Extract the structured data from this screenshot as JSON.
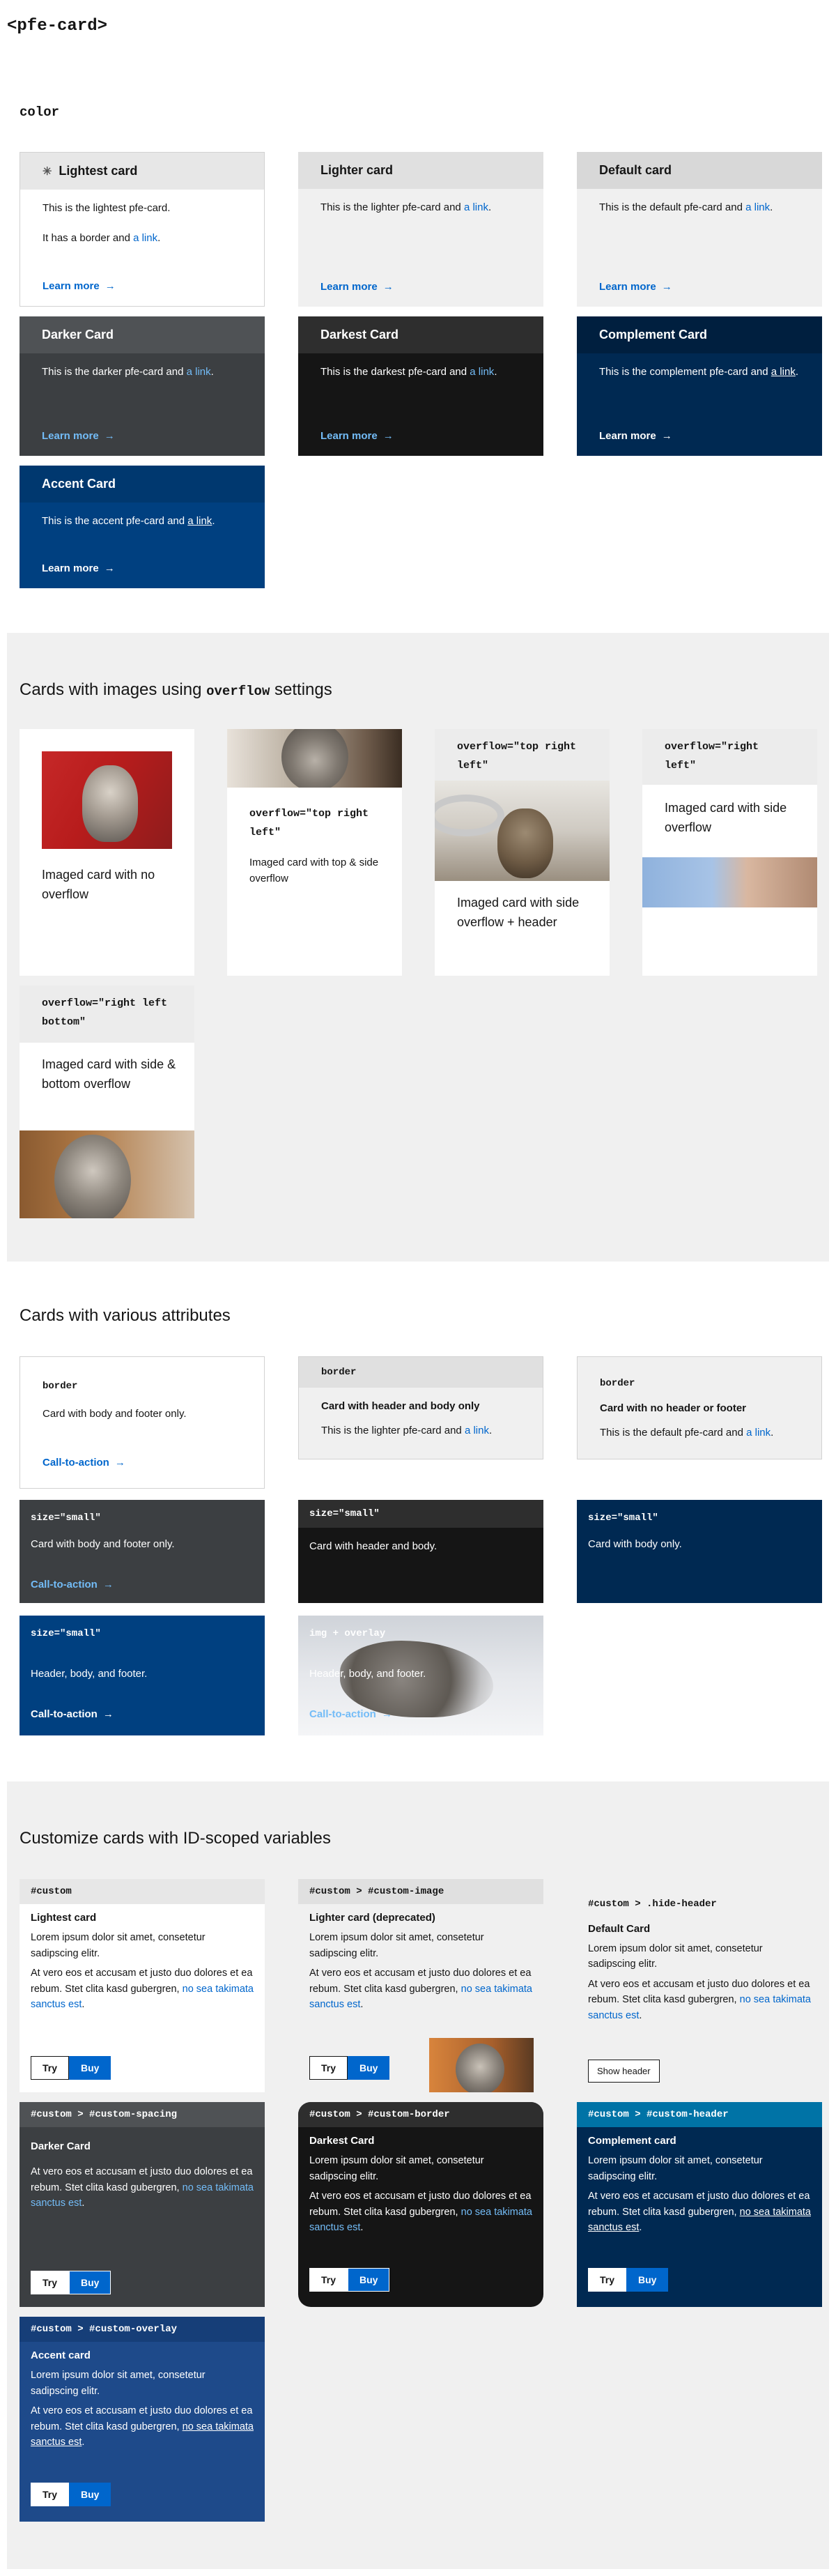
{
  "page_title": "<pfe-card>",
  "color_section": {
    "heading": "color",
    "cards": [
      {
        "title": "Lightest card",
        "body1": "This is the lightest pfe-card.",
        "body2": "It has a border and ",
        "link": "a link",
        "link_tail": ".",
        "footer": "Learn more"
      },
      {
        "title": "Lighter card",
        "body1": "This is the lighter pfe-card and ",
        "link": "a link",
        "link_tail": ".",
        "footer": "Learn more"
      },
      {
        "title": "Default card",
        "body1": "This is the default pfe-card and ",
        "link": "a link",
        "link_tail": ".",
        "footer": "Learn more"
      },
      {
        "title": "Darker Card",
        "body1": "This is the darker pfe-card and ",
        "link": "a link",
        "link_tail": ".",
        "footer": "Learn more"
      },
      {
        "title": "Darkest Card",
        "body1": "This is the darkest pfe-card and ",
        "link": "a link",
        "link_tail": ".",
        "footer": "Learn more"
      },
      {
        "title": "Complement Card",
        "body1": "This is the complement pfe-card and ",
        "link": "a link",
        "link_tail": ".",
        "footer": "Learn more"
      },
      {
        "title": "Accent Card",
        "body1": "This is the accent pfe-card and ",
        "link": "a link",
        "link_tail": ".",
        "footer": "Learn more"
      }
    ]
  },
  "images_section": {
    "heading_pre": "Cards with images using ",
    "heading_code": "overflow",
    "heading_post": " settings",
    "cards": [
      {
        "title": "Imaged card with no overflow"
      },
      {
        "code": "overflow=\"top right left\"",
        "title": "Imaged card with top & side overflow"
      },
      {
        "code": "overflow=\"top right left\"",
        "title": "Imaged card with side overflow + header"
      },
      {
        "code": "overflow=\"right left\"",
        "title": "Imaged card with side overflow"
      },
      {
        "code": "overflow=\"right left bottom\"",
        "title": "Imaged card with side & bottom overflow"
      }
    ]
  },
  "attrs_section": {
    "heading": "Cards with various attributes",
    "cards": [
      {
        "code": "border",
        "body": "Card with body and footer only.",
        "footer": "Call-to-action"
      },
      {
        "code": "border",
        "body": "Card with header and body only",
        "body2": "This is the lighter pfe-card and ",
        "link": "a link",
        "link_tail": "."
      },
      {
        "code": "border",
        "body": "Card with no header or footer",
        "body2": "This is the default pfe-card and ",
        "link": "a link",
        "link_tail": "."
      },
      {
        "code": "size=\"small\"",
        "body": "Card with body and footer only.",
        "footer": "Call-to-action"
      },
      {
        "code": "size=\"small\"",
        "body": "Card with header and body."
      },
      {
        "code": "size=\"small\"",
        "body": "Card with body only."
      },
      {
        "code": "size=\"small\"",
        "body": "Header, body, and footer.",
        "footer": "Call-to-action"
      },
      {
        "code": "img + overlay",
        "body": "Header, body, and footer.",
        "footer": "Call-to-action"
      }
    ]
  },
  "vars_section": {
    "heading": "Customize cards with ID-scoped variables",
    "p1": "Lorem ipsum dolor sit amet, consetetur sadipscing elitr.",
    "p2": "At vero eos et accusam et justo duo dolores et ea rebum. Stet clita kasd gubergren, ",
    "p2_link": "no sea takimata sanctus est",
    "p2_tail": ".",
    "try": "Try",
    "buy": "Buy",
    "cards": [
      {
        "code": "#custom",
        "title": "Lightest card"
      },
      {
        "code": "#custom > #custom-image",
        "title": "Lighter card (deprecated)"
      },
      {
        "code": "#custom > .hide-header",
        "title": "Default Card",
        "button": "Show header"
      },
      {
        "code": "#custom > #custom-spacing",
        "title": "Darker Card"
      },
      {
        "code": "#custom > #custom-border",
        "title": "Darkest Card"
      },
      {
        "code": "#custom > #custom-header",
        "title": "Complement card"
      },
      {
        "code": "#custom > #custom-overlay",
        "title": "Accent card"
      }
    ]
  },
  "icons": {
    "arrow": "arrow-right-icon",
    "bug": "bug-icon"
  }
}
